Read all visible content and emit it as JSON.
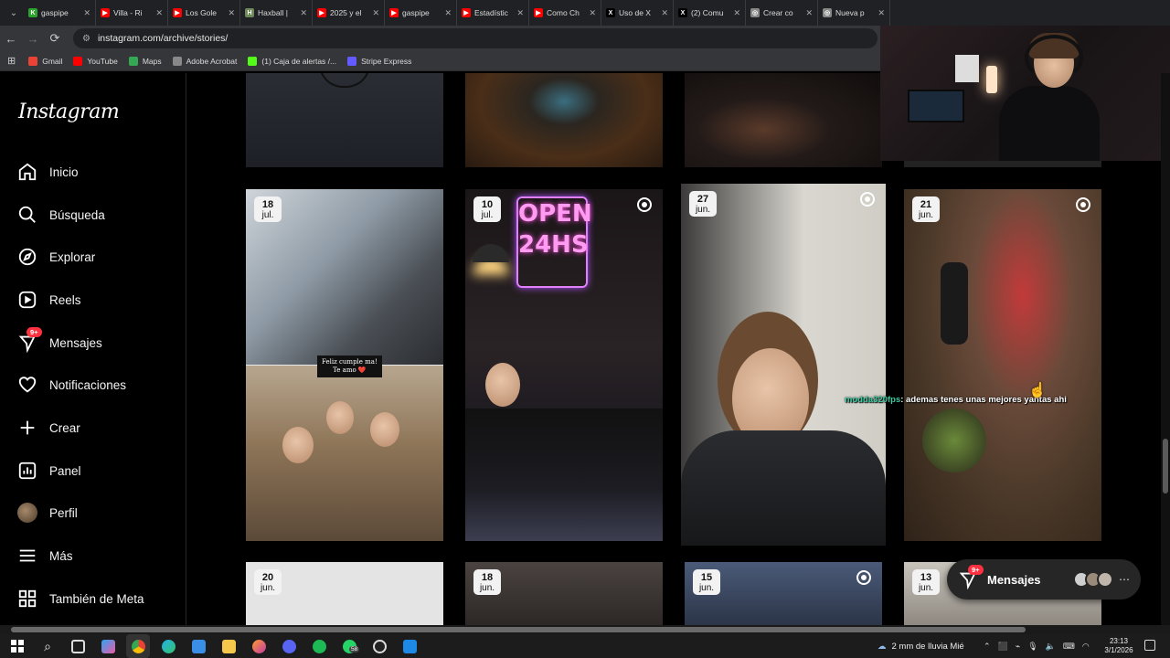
{
  "browser": {
    "tabs": [
      {
        "title": "gaspipe",
        "color": "#2ca32c",
        "glyph": "K"
      },
      {
        "title": "Villa - Ri",
        "color": "#ff0000",
        "glyph": "▶"
      },
      {
        "title": "Los Gole",
        "color": "#ff0000",
        "glyph": "▶"
      },
      {
        "title": "Haxball |",
        "color": "#6e8a5a",
        "glyph": "H"
      },
      {
        "title": "2025 y el",
        "color": "#ff0000",
        "glyph": "▶"
      },
      {
        "title": "gaspipe",
        "color": "#ff0000",
        "glyph": "▶"
      },
      {
        "title": "Estadístic",
        "color": "#ff0000",
        "glyph": "▶"
      },
      {
        "title": "Como Ch",
        "color": "#ff0000",
        "glyph": "▶"
      },
      {
        "title": "Uso de X",
        "color": "#000000",
        "glyph": "X"
      },
      {
        "title": "(2) Comu",
        "color": "#000000",
        "glyph": "X"
      },
      {
        "title": "Crear co",
        "color": "#888888",
        "glyph": "◎"
      },
      {
        "title": "Nueva p",
        "color": "#888888",
        "glyph": "◎"
      }
    ],
    "url": "instagram.com/archive/stories/",
    "bookmarks": [
      {
        "label": "Gmail",
        "color": "#ea4335"
      },
      {
        "label": "YouTube",
        "color": "#ff0000"
      },
      {
        "label": "Maps",
        "color": "#34a853"
      },
      {
        "label": "Adobe Acrobat",
        "color": "#888888"
      },
      {
        "label": "(1) Caja de alertas /...",
        "color": "#53fc18"
      },
      {
        "label": "Stripe Express",
        "color": "#635bff"
      }
    ]
  },
  "instagram": {
    "logo": "Instagram",
    "nav": [
      {
        "label": "Inicio",
        "icon": "home-icon"
      },
      {
        "label": "Búsqueda",
        "icon": "search-icon"
      },
      {
        "label": "Explorar",
        "icon": "compass-icon"
      },
      {
        "label": "Reels",
        "icon": "reels-icon"
      },
      {
        "label": "Mensajes",
        "icon": "messenger-icon",
        "badge": "9+"
      },
      {
        "label": "Notificaciones",
        "icon": "heart-icon"
      },
      {
        "label": "Crear",
        "icon": "plus-icon"
      },
      {
        "label": "Panel",
        "icon": "dashboard-icon"
      },
      {
        "label": "Perfil",
        "icon": "avatar"
      },
      {
        "label": "Más",
        "icon": "menu-icon"
      },
      {
        "label": "También de Meta",
        "icon": "meta-icon"
      }
    ],
    "stories": [
      {
        "day": "18",
        "month": "jul.",
        "caption_line1": "Feliz cumple ma!",
        "caption_line2": "Te amo ❤️"
      },
      {
        "day": "10",
        "month": "jul.",
        "neon1": "OPEN",
        "neon2": "24HS"
      },
      {
        "day": "27",
        "month": "jun."
      },
      {
        "day": "21",
        "month": "jun."
      },
      {
        "day": "20",
        "month": "jun."
      },
      {
        "day": "18",
        "month": "jun."
      },
      {
        "day": "15",
        "month": "jun."
      },
      {
        "day": "13",
        "month": "jun."
      }
    ],
    "messages_pill": {
      "label": "Mensajes",
      "badge": "9+"
    }
  },
  "chat_overlay": {
    "user": "modda320fps",
    "text": ": ademas tenes unas mejores yantas ahi"
  },
  "taskbar": {
    "weather": "2 mm de lluvia  Mié",
    "whatsapp_badge": "58",
    "time": "23:13",
    "date": "3/1/2026"
  }
}
